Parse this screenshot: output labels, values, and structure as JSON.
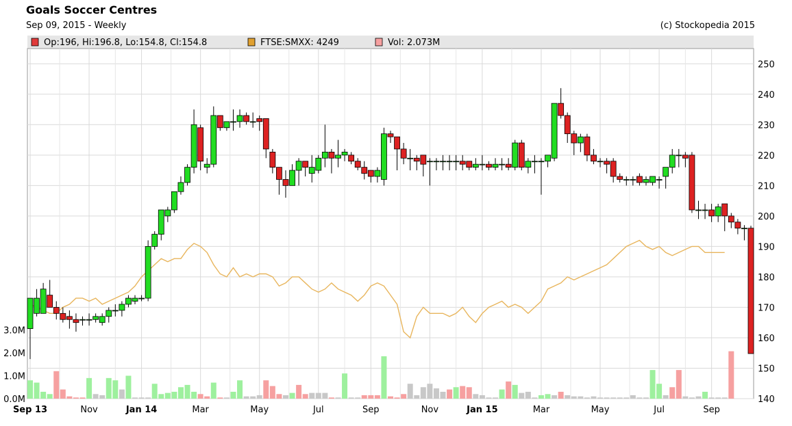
{
  "chart_data": {
    "type": "candlestick",
    "title": "Goals Soccer Centres",
    "subtitle": "Sep 09, 2015 - Weekly",
    "copyright": "(c) Stockopedia 2015",
    "legend": [
      {
        "label": "Op:196, Hi:196.8, Lo:154.8, Cl:154.8",
        "color": "#e03a3a"
      },
      {
        "label": "FTSE:SMXX: 4249",
        "color": "#e0a030"
      },
      {
        "label": "Vol: 2.073M",
        "color": "#f6a0a0"
      }
    ],
    "price_axis": {
      "min": 140,
      "max": 255,
      "ticks": [
        140,
        150,
        160,
        170,
        180,
        190,
        200,
        210,
        220,
        230,
        240,
        250
      ]
    },
    "volume_axis": {
      "labels": [
        "0.0M",
        "1.0M",
        "2.0M",
        "3.0M"
      ],
      "values": [
        0,
        1,
        2,
        3
      ]
    },
    "x_labels": [
      {
        "label": "Sep 13",
        "week": 0,
        "bold": true
      },
      {
        "label": "Nov",
        "week": 9,
        "bold": false
      },
      {
        "label": "Jan 14",
        "week": 17,
        "bold": true
      },
      {
        "label": "Mar",
        "week": 26,
        "bold": false
      },
      {
        "label": "May",
        "week": 35,
        "bold": false
      },
      {
        "label": "Jul",
        "week": 44,
        "bold": false
      },
      {
        "label": "Sep",
        "week": 52,
        "bold": false
      },
      {
        "label": "Nov",
        "week": 61,
        "bold": false
      },
      {
        "label": "Jan 15",
        "week": 69,
        "bold": true
      },
      {
        "label": "Mar",
        "week": 78,
        "bold": false
      },
      {
        "label": "May",
        "week": 87,
        "bold": false
      },
      {
        "label": "Jul",
        "week": 96,
        "bold": false
      },
      {
        "label": "Sep",
        "week": 104,
        "bold": false
      }
    ],
    "candles": [
      [
        163,
        173,
        153,
        173
      ],
      [
        168,
        176,
        167,
        173
      ],
      [
        168,
        178,
        168,
        176
      ],
      [
        174,
        179,
        170,
        170
      ],
      [
        170,
        172,
        166,
        168
      ],
      [
        168,
        170,
        165,
        166
      ],
      [
        167,
        169,
        163,
        166
      ],
      [
        166,
        168,
        162,
        165
      ],
      [
        166,
        167,
        164,
        166
      ],
      [
        166,
        168,
        164,
        166
      ],
      [
        166,
        168,
        165,
        167
      ],
      [
        165,
        168,
        164,
        167
      ],
      [
        167,
        170,
        165,
        169
      ],
      [
        169,
        171,
        167,
        169
      ],
      [
        169,
        172,
        167,
        171
      ],
      [
        171,
        174,
        170,
        173
      ],
      [
        172,
        174,
        171,
        173
      ],
      [
        173,
        174,
        172,
        173
      ],
      [
        173,
        192,
        172,
        190
      ],
      [
        190,
        195,
        189,
        194
      ],
      [
        194,
        200,
        192,
        202
      ],
      [
        200,
        203,
        198,
        202
      ],
      [
        202,
        208,
        201,
        208
      ],
      [
        208,
        213,
        207,
        211
      ],
      [
        211,
        217,
        210,
        216
      ],
      [
        216,
        235,
        214,
        230
      ],
      [
        229,
        230,
        215,
        218
      ],
      [
        216,
        219,
        214,
        217
      ],
      [
        217,
        236,
        216,
        233
      ],
      [
        233,
        233,
        228,
        229
      ],
      [
        229,
        231,
        228,
        231
      ],
      [
        231,
        235,
        228,
        231
      ],
      [
        231,
        235,
        229,
        233
      ],
      [
        233,
        234,
        230,
        231
      ],
      [
        231,
        234,
        229,
        231
      ],
      [
        232,
        233,
        228,
        231
      ],
      [
        232,
        232,
        219,
        222
      ],
      [
        221,
        222,
        214,
        216
      ],
      [
        216,
        216,
        207,
        212
      ],
      [
        212,
        215,
        206,
        210
      ],
      [
        210,
        217,
        210,
        215
      ],
      [
        215,
        219,
        210,
        218
      ],
      [
        218,
        218,
        213,
        216
      ],
      [
        214,
        220,
        211,
        216
      ],
      [
        215,
        220,
        214,
        219
      ],
      [
        219,
        230,
        216,
        221
      ],
      [
        221,
        222,
        214,
        219
      ],
      [
        219,
        225,
        216,
        220
      ],
      [
        220,
        222,
        218,
        221
      ],
      [
        220,
        221,
        217,
        218
      ],
      [
        218,
        219,
        215,
        216
      ],
      [
        216,
        218,
        212,
        214
      ],
      [
        215,
        215,
        211,
        213
      ],
      [
        213,
        216,
        211,
        215
      ],
      [
        212,
        229,
        210,
        227
      ],
      [
        227,
        228,
        224,
        226
      ],
      [
        226,
        226,
        215,
        222
      ],
      [
        222,
        224,
        217,
        219
      ],
      [
        219,
        222,
        215,
        219
      ],
      [
        219,
        220,
        215,
        218
      ],
      [
        220,
        220,
        213,
        217
      ],
      [
        218,
        219,
        210,
        218
      ],
      [
        218,
        219,
        215,
        218
      ],
      [
        218,
        220,
        215,
        218
      ],
      [
        218,
        220,
        215,
        218
      ],
      [
        218,
        220,
        215,
        218
      ],
      [
        218,
        220,
        215,
        217
      ],
      [
        218,
        218,
        215,
        216
      ],
      [
        216,
        219,
        215,
        217
      ],
      [
        217,
        220,
        215,
        217
      ],
      [
        217,
        218,
        215,
        216
      ],
      [
        216,
        219,
        215,
        217
      ],
      [
        217,
        219,
        215,
        217
      ],
      [
        217,
        219,
        215,
        216
      ],
      [
        216,
        225,
        215,
        224
      ],
      [
        224,
        225,
        215,
        216
      ],
      [
        216,
        219,
        214,
        218
      ],
      [
        218,
        220,
        214,
        218
      ],
      [
        218,
        219,
        207,
        218
      ],
      [
        218,
        220,
        216,
        220
      ],
      [
        219,
        237,
        218,
        237
      ],
      [
        237,
        242,
        232,
        233
      ],
      [
        233,
        234,
        224,
        227
      ],
      [
        227,
        228,
        220,
        224
      ],
      [
        224,
        227,
        221,
        226
      ],
      [
        226,
        227,
        218,
        220
      ],
      [
        220,
        222,
        217,
        218
      ],
      [
        218,
        219,
        216,
        218
      ],
      [
        218,
        219,
        214,
        217
      ],
      [
        218,
        219,
        211,
        213
      ],
      [
        213,
        214,
        211,
        212
      ],
      [
        212,
        213,
        210,
        212
      ],
      [
        212,
        213,
        210,
        212
      ],
      [
        213,
        214,
        210,
        211
      ],
      [
        211,
        213,
        210,
        212
      ],
      [
        211,
        213,
        210,
        213
      ],
      [
        212,
        213,
        209,
        212
      ],
      [
        213,
        216,
        209,
        216
      ],
      [
        216,
        222,
        214,
        220
      ],
      [
        220,
        222,
        216,
        220
      ],
      [
        220,
        221,
        216,
        219
      ],
      [
        220,
        221,
        201,
        202
      ],
      [
        202,
        205,
        199,
        202
      ],
      [
        202,
        204,
        199,
        202
      ],
      [
        202,
        204,
        198,
        200
      ],
      [
        200,
        204,
        198,
        203
      ],
      [
        204,
        204,
        195,
        200
      ],
      [
        200,
        201,
        196,
        198
      ],
      [
        198,
        199,
        194,
        196
      ],
      [
        196,
        197,
        192,
        196
      ],
      [
        196,
        196.8,
        154.8,
        154.8
      ]
    ],
    "ftse_line": [
      171,
      170,
      169,
      168,
      168,
      170,
      171,
      173,
      173,
      172,
      173,
      171,
      172,
      173,
      174,
      175,
      177,
      180,
      182,
      184,
      186,
      185,
      186,
      186,
      189,
      191,
      190,
      188,
      184,
      181,
      180,
      183,
      180,
      181,
      180,
      181,
      181,
      180,
      177,
      178,
      180,
      180,
      178,
      176,
      175,
      176,
      178,
      176,
      175,
      174,
      172,
      174,
      177,
      178,
      177,
      174,
      171,
      162,
      160,
      167,
      170,
      168,
      168,
      168,
      167,
      168,
      170,
      167,
      165,
      168,
      170,
      171,
      172,
      170,
      171,
      170,
      168,
      170,
      172,
      176,
      177,
      178,
      180,
      179,
      180,
      181,
      182,
      183,
      184,
      186,
      188,
      190,
      191,
      192,
      190,
      189,
      190,
      188,
      187,
      188,
      189,
      190,
      190,
      188,
      188,
      188,
      188
    ],
    "volumes": [
      [
        0.8,
        "green"
      ],
      [
        0.7,
        "green"
      ],
      [
        0.3,
        "green"
      ],
      [
        0.2,
        "green"
      ],
      [
        1.2,
        "red"
      ],
      [
        0.4,
        "red"
      ],
      [
        0.1,
        "red"
      ],
      [
        0.05,
        "red"
      ],
      [
        0.05,
        "red"
      ],
      [
        0.9,
        "green"
      ],
      [
        0.2,
        "gray"
      ],
      [
        0.15,
        "gray"
      ],
      [
        0.9,
        "green"
      ],
      [
        0.8,
        "green"
      ],
      [
        0.4,
        "gray"
      ],
      [
        1.0,
        "green"
      ],
      [
        0.05,
        "gray"
      ],
      [
        0.05,
        "gray"
      ],
      [
        0.05,
        "gray"
      ],
      [
        0.65,
        "green"
      ],
      [
        0.2,
        "green"
      ],
      [
        0.25,
        "green"
      ],
      [
        0.3,
        "green"
      ],
      [
        0.5,
        "green"
      ],
      [
        0.6,
        "green"
      ],
      [
        0.3,
        "green"
      ],
      [
        0.2,
        "red"
      ],
      [
        0.1,
        "red"
      ],
      [
        0.7,
        "green"
      ],
      [
        0.05,
        "red"
      ],
      [
        0.05,
        "gray"
      ],
      [
        0.3,
        "green"
      ],
      [
        0.8,
        "green"
      ],
      [
        0.1,
        "gray"
      ],
      [
        0.1,
        "gray"
      ],
      [
        0.15,
        "gray"
      ],
      [
        0.8,
        "red"
      ],
      [
        0.55,
        "red"
      ],
      [
        0.2,
        "red"
      ],
      [
        0.15,
        "gray"
      ],
      [
        0.25,
        "green"
      ],
      [
        0.6,
        "red"
      ],
      [
        0.2,
        "red"
      ],
      [
        0.25,
        "gray"
      ],
      [
        0.25,
        "gray"
      ],
      [
        0.25,
        "gray"
      ],
      [
        0.05,
        "red"
      ],
      [
        0.05,
        "gray"
      ],
      [
        1.1,
        "green"
      ],
      [
        0.05,
        "gray"
      ],
      [
        0.05,
        "gray"
      ],
      [
        0.15,
        "red"
      ],
      [
        0.15,
        "red"
      ],
      [
        0.15,
        "red"
      ],
      [
        1.85,
        "green"
      ],
      [
        0.1,
        "red"
      ],
      [
        0.05,
        "red"
      ],
      [
        0.2,
        "red"
      ],
      [
        0.65,
        "gray"
      ],
      [
        0.15,
        "gray"
      ],
      [
        0.5,
        "gray"
      ],
      [
        0.65,
        "gray"
      ],
      [
        0.45,
        "gray"
      ],
      [
        0.3,
        "gray"
      ],
      [
        0.4,
        "red"
      ],
      [
        0.5,
        "green"
      ],
      [
        0.55,
        "red"
      ],
      [
        0.5,
        "red"
      ],
      [
        0.2,
        "gray"
      ],
      [
        0.15,
        "gray"
      ],
      [
        0.05,
        "gray"
      ],
      [
        0.05,
        "gray"
      ],
      [
        0.4,
        "green"
      ],
      [
        0.75,
        "red"
      ],
      [
        0.6,
        "green"
      ],
      [
        0.25,
        "gray"
      ],
      [
        0.3,
        "gray"
      ],
      [
        0.05,
        "gray"
      ],
      [
        0.15,
        "green"
      ],
      [
        0.2,
        "green"
      ],
      [
        0.15,
        "gray"
      ],
      [
        0.3,
        "red"
      ],
      [
        0.15,
        "gray"
      ],
      [
        0.1,
        "gray"
      ],
      [
        0.1,
        "gray"
      ],
      [
        0.05,
        "gray"
      ],
      [
        0.1,
        "gray"
      ],
      [
        0.05,
        "gray"
      ],
      [
        0.05,
        "gray"
      ],
      [
        0.05,
        "gray"
      ],
      [
        0.05,
        "gray"
      ],
      [
        0.05,
        "gray"
      ],
      [
        0.15,
        "gray"
      ],
      [
        0.05,
        "gray"
      ],
      [
        0.05,
        "gray"
      ],
      [
        1.25,
        "green"
      ],
      [
        0.65,
        "green"
      ],
      [
        0.15,
        "gray"
      ],
      [
        0.5,
        "red"
      ],
      [
        1.25,
        "red"
      ],
      [
        0.1,
        "gray"
      ],
      [
        0.05,
        "gray"
      ],
      [
        0.1,
        "gray"
      ],
      [
        0.3,
        "green"
      ],
      [
        0.05,
        "gray"
      ],
      [
        0.05,
        "gray"
      ],
      [
        0.05,
        "gray"
      ],
      [
        2.07,
        "red"
      ]
    ]
  }
}
